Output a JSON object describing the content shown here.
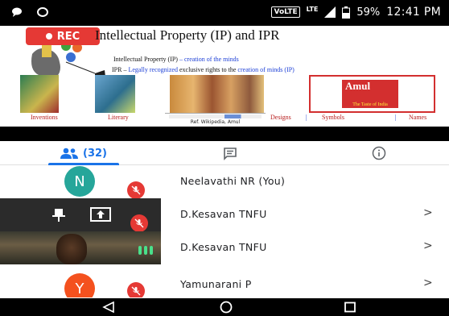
{
  "status_bar": {
    "volte": "VoLTE",
    "lte": "LTE",
    "battery": "59%",
    "time": "12:41 PM"
  },
  "slide": {
    "rec_label": "REC",
    "title": "Intellectual Property (IP) and IPR",
    "line1_a": "Intellectual Property (IP)",
    "line1_b": "– creation of the minds",
    "line2_a": "IPR –",
    "line2_b": "Legally recognized",
    "line2_c": "exclusive rights to the",
    "line2_d": "creation of minds (IP)",
    "captions": [
      "Inventions",
      "Literary",
      "Designs",
      "Symbols",
      "Names"
    ],
    "reference": "Ref. Wikipedia, Amul",
    "amul_logo": "Amul",
    "amul_tagline": "The Taste of India"
  },
  "tabs": {
    "people_count": "(32)",
    "people_icon": "people-icon",
    "chat_icon": "chat-icon",
    "info_icon": "info-icon"
  },
  "participants": [
    {
      "name": "Neelavathi NR (You)",
      "avatar_letter": "N",
      "avatar_color": "#26a69a",
      "muted": true
    },
    {
      "name": "D.Kesavan TNFU",
      "presenting": true,
      "muted": true
    },
    {
      "name": "D.Kesavan TNFU",
      "video": true
    },
    {
      "name": "Yamunarani P",
      "avatar_letter": "Y",
      "avatar_color": "#f4511e",
      "muted": true
    }
  ],
  "colors": {
    "accent": "#1a73e8",
    "mute_red": "#e53935",
    "speaking_green": "#49e08b"
  }
}
